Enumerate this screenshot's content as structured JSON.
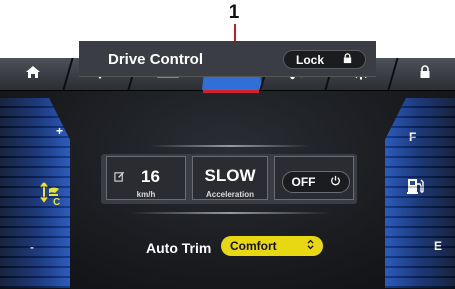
{
  "callout": {
    "number": "1"
  },
  "tabs": [
    {
      "name": "home",
      "icon": "home-icon"
    },
    {
      "name": "navigation",
      "icon": "location-pin-icon"
    },
    {
      "name": "ruler",
      "icon": "ruler-icon"
    },
    {
      "name": "drive",
      "icon": "speedometer-icon",
      "active": true
    },
    {
      "name": "music",
      "icon": "music-note-icon"
    },
    {
      "name": "settings",
      "icon": "gear-icon"
    },
    {
      "name": "lock",
      "icon": "lock-icon"
    }
  ],
  "panel": {
    "title": "Drive Control",
    "lock_label": "Lock"
  },
  "left_gauge": {
    "plus": "+",
    "minus": "-",
    "sub": "C",
    "icon": "climate-icon"
  },
  "right_gauge": {
    "full": "F",
    "empty": "E",
    "icon": "fuel-pump-icon"
  },
  "speed": {
    "value": "16",
    "unit": "km/h",
    "icon": "edit-icon"
  },
  "acceleration": {
    "value": "SLOW",
    "label": "Acceleration"
  },
  "cruise": {
    "label": "OFF",
    "icon": "power-icon"
  },
  "auto_trim": {
    "label": "Auto Trim",
    "value": "Comfort"
  },
  "colors": {
    "accent": "#2f6fd6",
    "active_underline": "#d2222c",
    "select_bg": "#e7d811",
    "callout_line": "#c0202a"
  }
}
